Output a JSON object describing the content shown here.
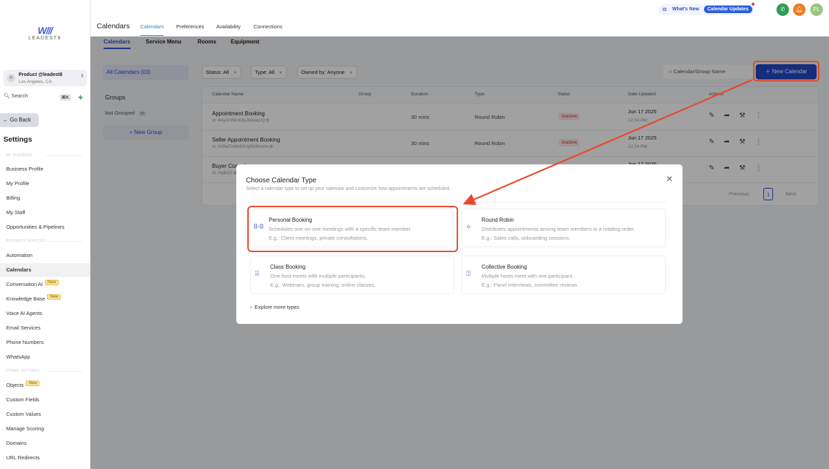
{
  "sidebar": {
    "logo_mark": "W///",
    "logo_text": "LEADEST8",
    "account": {
      "name": "Product @leadest8",
      "location": "Los Angeles, CA"
    },
    "search": {
      "label": "Search",
      "shortcut": "⌘K"
    },
    "go_back": "← Go Back",
    "title": "Settings",
    "sections": [
      "MY BUSINESS",
      "BUSINESS SERVICES",
      "OTHER SETTINGS"
    ],
    "items": [
      {
        "label": "Business Profile"
      },
      {
        "label": "My Profile"
      },
      {
        "label": "Billing"
      },
      {
        "label": "My Staff"
      },
      {
        "label": "Opportunities & Pipelines"
      },
      {
        "label": "Automation"
      },
      {
        "label": "Calendars",
        "active": true
      },
      {
        "label": "Conversation AI",
        "badge": "New"
      },
      {
        "label": "Knowledge Base",
        "badge": "New"
      },
      {
        "label": "Voice AI Agents"
      },
      {
        "label": "Email Services"
      },
      {
        "label": "Phone Numbers"
      },
      {
        "label": "WhatsApp"
      },
      {
        "label": "Objects",
        "badge": "New"
      },
      {
        "label": "Custom Fields"
      },
      {
        "label": "Custom Values"
      },
      {
        "label": "Manage Scoring"
      },
      {
        "label": "Domains"
      },
      {
        "label": "URL Redirects"
      }
    ]
  },
  "header": {
    "title": "Calendars",
    "tabs": [
      "Calendars",
      "Preferences",
      "Availability",
      "Connections"
    ],
    "whats_new": "What's New",
    "updates_badge": "Calendar Updates",
    "avatar": "PL"
  },
  "subtabs": [
    "Calendars",
    "Service Menu",
    "Rooms",
    "Equipment"
  ],
  "groups_panel": {
    "all": "All Calendars (03)",
    "title": "Groups",
    "not_grouped": "Not Grouped",
    "not_grouped_count": "03",
    "new_group": "+ New Group"
  },
  "filters": {
    "status": "Status: All",
    "type": "Type: All",
    "owner": "Owned by: Anyone",
    "search_placeholder": "Calendar/Group Name",
    "new_calendar": "New Calendar"
  },
  "table": {
    "columns": [
      "Calendar Name",
      "Group",
      "Duration",
      "Type",
      "Status",
      "Date Updated",
      "Actions"
    ],
    "rows": [
      {
        "name": "Appointment Booking",
        "id": "id: 4r4yGhfMUK8yJ6ikwqUQ",
        "duration": "30 mins",
        "type": "Round Robin",
        "status": "Inactive",
        "date": "Jun 17 2025",
        "time": "12:24 PM"
      },
      {
        "name": "Seller Appointment Booking",
        "id": "id: 5XRwTuWkE4YqRl89KwHx",
        "duration": "30 mins",
        "type": "Round Robin",
        "status": "Inactive",
        "date": "Jun 17 2025",
        "time": "12:24 PM"
      },
      {
        "name": "Buyer Consult",
        "id": "id: iXplld32",
        "duration": "",
        "type": "",
        "status": "",
        "date": "Jun 17 2025",
        "time": ""
      }
    ],
    "pagination": {
      "prev": "Previous",
      "page": "1",
      "next": "Next"
    }
  },
  "modal": {
    "title": "Choose Calendar Type",
    "subtitle": "Select a calendar type to set up your calendar and customize how appointments are scheduled.",
    "cards": [
      {
        "title": "Personal Booking",
        "desc": "Schedules one-on-one meetings with a specific team member.",
        "example": "E.g.: Client meetings, private consultations."
      },
      {
        "title": "Round Robin",
        "desc": "Distributes appointments among team members in a rotating order.",
        "example": "E.g.: Sales calls, onboarding sessions."
      },
      {
        "title": "Class Booking",
        "desc": "One host meets with multiple participants.",
        "example": "E.g.: Webinars, group training, online classes."
      },
      {
        "title": "Collective Booking",
        "desc": "Multiple hosts meet with one participant.",
        "example": "E.g.: Panel interviews, committee reviews."
      }
    ],
    "explore": "Explore more types"
  },
  "colors": {
    "accent": "#2448c7",
    "annotation": "#e8472c"
  }
}
